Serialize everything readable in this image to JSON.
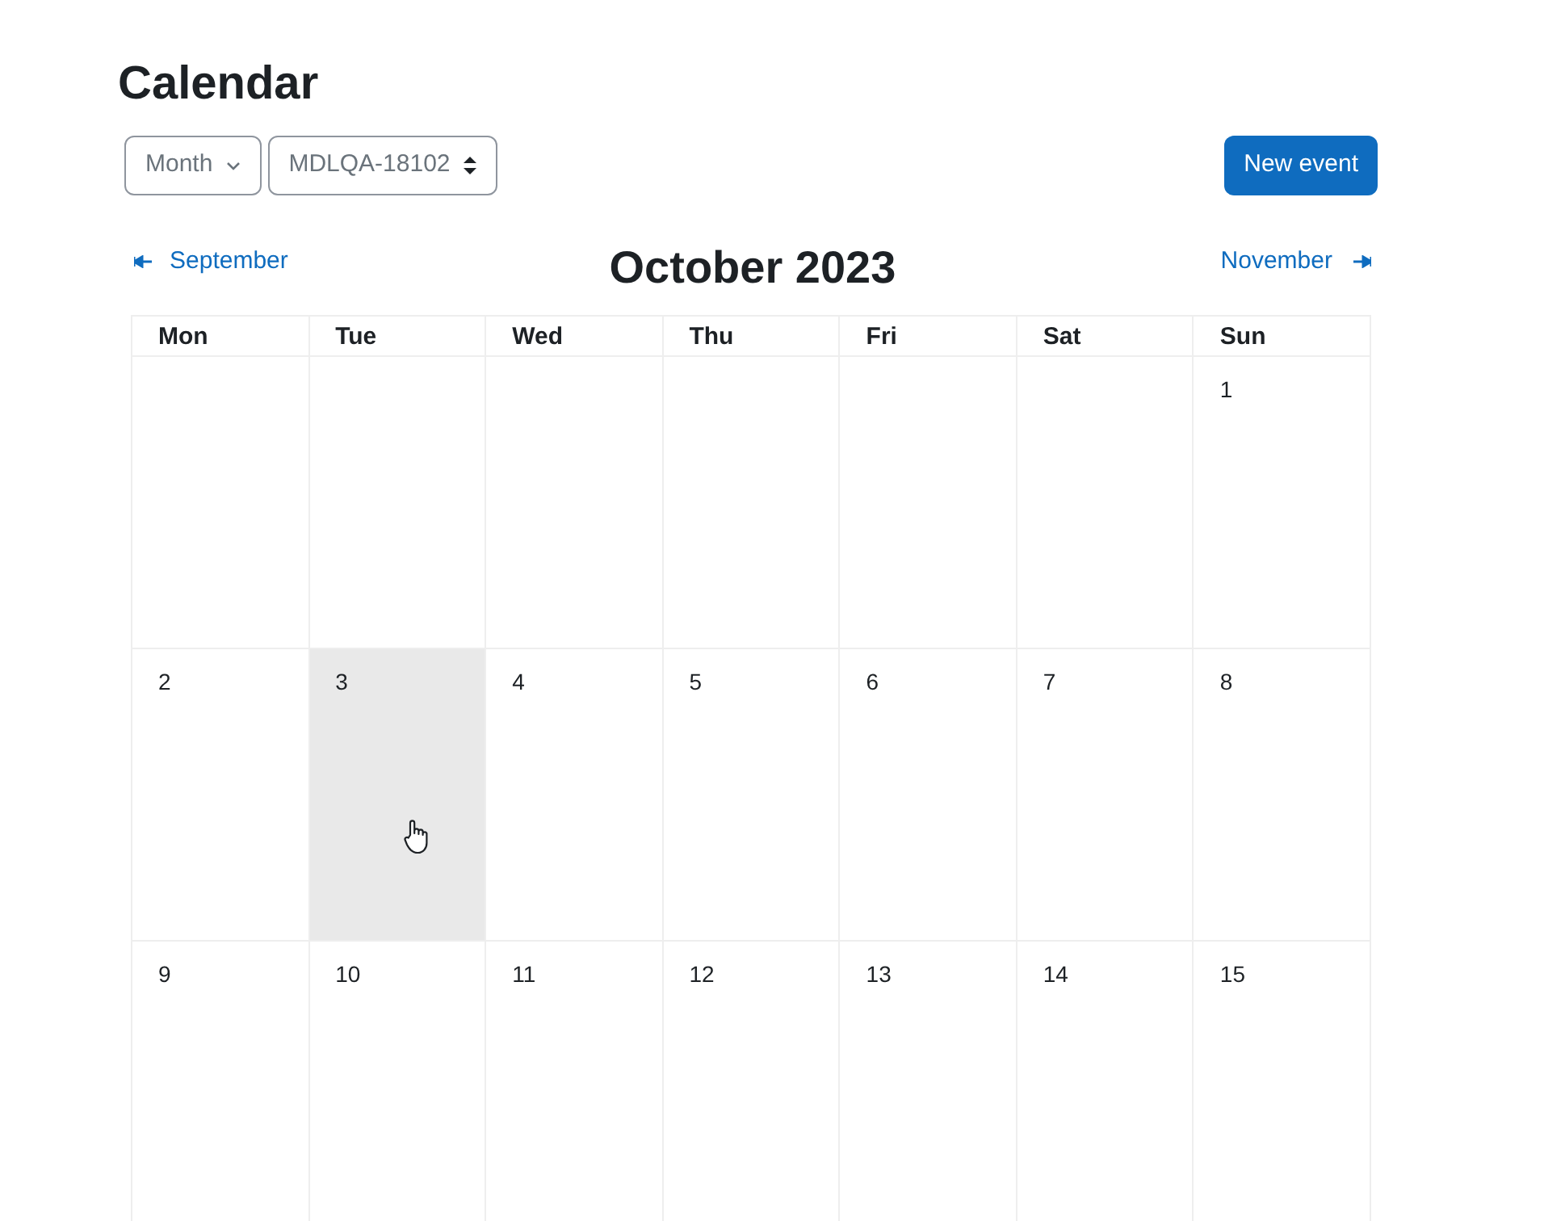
{
  "page": {
    "title": "Calendar"
  },
  "controls": {
    "view_select": "Month",
    "course_select": "MDLQA-18102",
    "new_event_button": "New event"
  },
  "navigation": {
    "previous": "September",
    "current": "October 2023",
    "next": "November"
  },
  "calendar": {
    "weekdays": [
      "Mon",
      "Tue",
      "Wed",
      "Thu",
      "Fri",
      "Sat",
      "Sun"
    ],
    "weeks": [
      [
        {
          "hovered": false
        },
        {
          "hovered": false
        },
        {
          "hovered": false
        },
        {
          "hovered": false
        },
        {
          "hovered": false
        },
        {
          "hovered": false
        },
        {
          "day": "1",
          "hovered": false
        }
      ],
      [
        {
          "day": "2",
          "hovered": false
        },
        {
          "day": "3",
          "hovered": true
        },
        {
          "day": "4",
          "hovered": false
        },
        {
          "day": "5",
          "hovered": false
        },
        {
          "day": "6",
          "hovered": false
        },
        {
          "day": "7",
          "hovered": false
        },
        {
          "day": "8",
          "hovered": false
        }
      ],
      [
        {
          "day": "9",
          "hovered": false
        },
        {
          "day": "10",
          "hovered": false
        },
        {
          "day": "11",
          "hovered": false
        },
        {
          "day": "12",
          "hovered": false
        },
        {
          "day": "13",
          "hovered": false
        },
        {
          "day": "14",
          "hovered": false
        },
        {
          "day": "15",
          "hovered": false
        }
      ]
    ]
  }
}
